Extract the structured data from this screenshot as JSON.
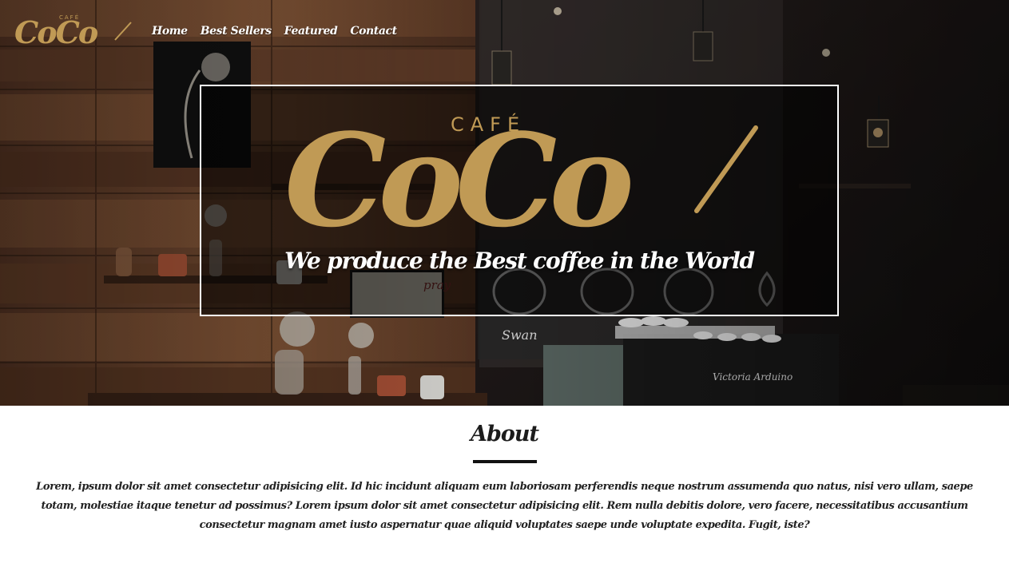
{
  "brand": {
    "logo_small_label": "CAFÉ",
    "logo_small_word": "CoCo",
    "color_gold": "#c09a55"
  },
  "nav": {
    "items": [
      {
        "label": "Home"
      },
      {
        "label": "Best Sellers"
      },
      {
        "label": "Featured"
      },
      {
        "label": "Contact"
      }
    ]
  },
  "hero": {
    "logo_label": "CAFÉ",
    "logo_word": "CoCo",
    "tagline": "We produce the Best coffee in the World",
    "background_scene": {
      "shop_sign": "pray",
      "counter_label": "Swan",
      "machine_brand": "Victoria Arduino"
    }
  },
  "about": {
    "title": "About",
    "body": "Lorem, ipsum dolor sit amet consectetur adipisicing elit. Id hic incidunt aliquam eum laboriosam perferendis neque nostrum assumenda quo natus, nisi vero ullam, saepe totam, molestiae itaque tenetur ad possimus? Lorem ipsum dolor sit amet consectetur adipisicing elit. Rem nulla debitis dolore, vero facere, necessitatibus accusantium consectetur magnam amet iusto aspernatur quae aliquid voluptates saepe unde voluptate expedita. Fugit, iste?"
  }
}
